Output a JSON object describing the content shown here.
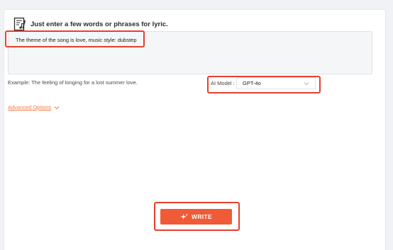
{
  "header": {
    "title": "Just enter a few words or phrases for lyric.",
    "icon": "music-notepad-icon"
  },
  "lyric_input": {
    "value": "The theme of the song is love, music style: dubstep"
  },
  "example": {
    "text": "Example: The feeling of longing for a lost summer love."
  },
  "ai_model": {
    "label": "AI Model :",
    "selected": "GPT-4o"
  },
  "advanced_options": {
    "label": "Advanced Options"
  },
  "write_button": {
    "label": "WRITE",
    "icon": "sparkle-icon"
  },
  "colors": {
    "accent": "#ef5b37",
    "link": "#f47a45",
    "highlight": "#e4412d"
  }
}
